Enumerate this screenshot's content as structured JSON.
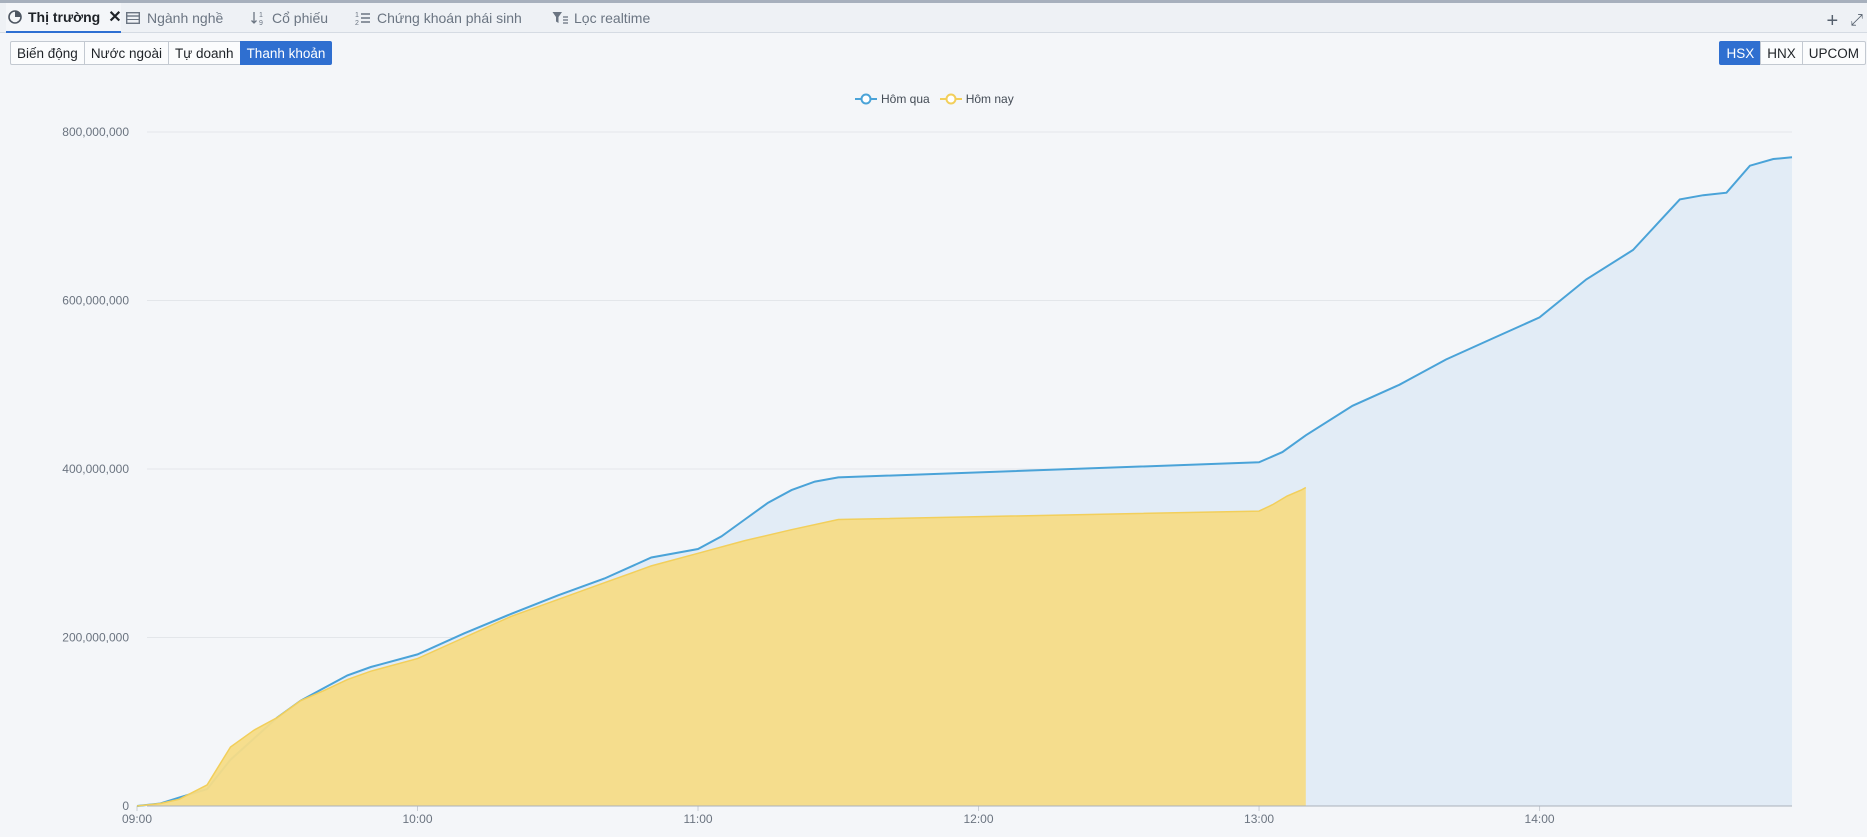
{
  "tabs": [
    {
      "label": "Thị trường",
      "icon": "pie-chart-icon",
      "active": true
    },
    {
      "label": "Ngành nghề",
      "icon": "table-icon",
      "active": false
    },
    {
      "label": "Cổ phiếu",
      "icon": "sort-icon",
      "active": false
    },
    {
      "label": "Chứng khoán phái sinh",
      "icon": "numbered-list-icon",
      "active": false
    },
    {
      "label": "Lọc realtime",
      "icon": "filter-icon",
      "active": false
    }
  ],
  "tab_tools": {
    "add_icon": "plus-icon",
    "expand_icon": "expand-icon",
    "add_symbol": "+",
    "expand_symbol": "⤢"
  },
  "view_buttons": [
    {
      "label": "Biến động",
      "selected": false
    },
    {
      "label": "Nước ngoài",
      "selected": false
    },
    {
      "label": "Tự doanh",
      "selected": false
    },
    {
      "label": "Thanh khoản",
      "selected": true
    }
  ],
  "exchange_buttons": [
    {
      "label": "HSX",
      "selected": true
    },
    {
      "label": "HNX",
      "selected": false
    },
    {
      "label": "UPCOM",
      "selected": false
    }
  ],
  "colors": {
    "accent": "#2f6fd0",
    "yesterday_line": "#4aa3d8",
    "yesterday_fill": "#e2ecf6",
    "today_fill": "#f6dc87",
    "today_line": "#f2cf5b"
  },
  "chart_data": {
    "type": "area",
    "title": "",
    "xlabel": "",
    "ylabel": "",
    "ylim": [
      0,
      800000000
    ],
    "yticks": [
      0,
      200000000,
      400000000,
      600000000,
      800000000
    ],
    "ytick_labels": [
      "0",
      "200,000,000",
      "400,000,000",
      "600,000,000",
      "800,000,000"
    ],
    "xlim": [
      "09:00",
      "14:54"
    ],
    "xticks": [
      "09:00",
      "10:00",
      "11:00",
      "12:00",
      "13:00",
      "14:00"
    ],
    "legend": "top-center",
    "grid": true,
    "series": [
      {
        "name": "Hôm qua",
        "x": [
          "09:00",
          "09:05",
          "09:09",
          "09:15",
          "09:20",
          "09:25",
          "09:30",
          "09:35",
          "09:40",
          "09:45",
          "09:50",
          "10:00",
          "10:10",
          "10:20",
          "10:30",
          "10:40",
          "10:50",
          "11:00",
          "11:05",
          "11:10",
          "11:15",
          "11:20",
          "11:25",
          "11:30",
          "13:00",
          "13:05",
          "13:10",
          "13:20",
          "13:30",
          "13:40",
          "13:50",
          "14:00",
          "14:10",
          "14:20",
          "14:25",
          "14:30",
          "14:35",
          "14:40",
          "14:45",
          "14:50",
          "14:54"
        ],
        "values": [
          0,
          3000000,
          10000000,
          20000000,
          55000000,
          80000000,
          105000000,
          125000000,
          140000000,
          155000000,
          165000000,
          180000000,
          205000000,
          228000000,
          250000000,
          270000000,
          295000000,
          305000000,
          320000000,
          340000000,
          360000000,
          375000000,
          385000000,
          390000000,
          408000000,
          420000000,
          440000000,
          475000000,
          500000000,
          530000000,
          555000000,
          580000000,
          625000000,
          660000000,
          690000000,
          720000000,
          725000000,
          728000000,
          760000000,
          768000000,
          770000000
        ]
      },
      {
        "name": "Hôm nay",
        "x": [
          "09:00",
          "09:05",
          "09:09",
          "09:15",
          "09:20",
          "09:25",
          "09:30",
          "09:35",
          "09:40",
          "09:45",
          "09:50",
          "10:00",
          "10:10",
          "10:20",
          "10:30",
          "10:40",
          "10:50",
          "11:00",
          "11:10",
          "11:20",
          "11:30",
          "13:00",
          "13:03",
          "13:06",
          "13:09",
          "13:10"
        ],
        "values": [
          0,
          3000000,
          8000000,
          25000000,
          70000000,
          90000000,
          105000000,
          125000000,
          137000000,
          150000000,
          160000000,
          175000000,
          200000000,
          225000000,
          245000000,
          265000000,
          285000000,
          300000000,
          315000000,
          328000000,
          340000000,
          350000000,
          358000000,
          368000000,
          375000000,
          378000000
        ]
      }
    ]
  }
}
